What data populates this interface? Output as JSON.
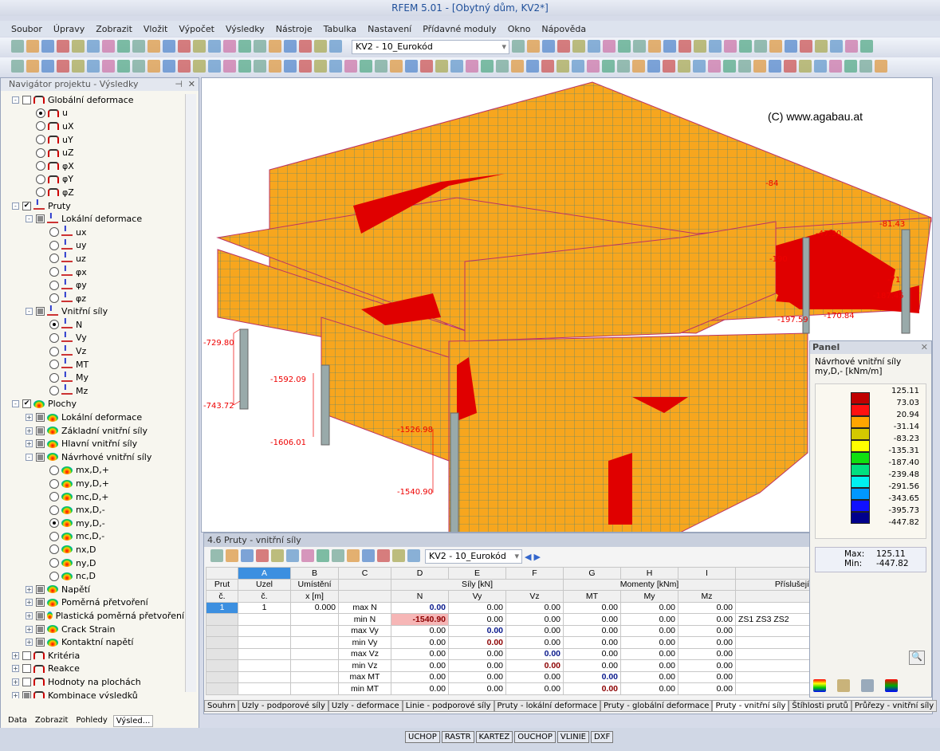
{
  "window": {
    "title": "RFEM 5.01 - [Obytný dům, KV2*]"
  },
  "menu": [
    "Soubor",
    "Úpravy",
    "Zobrazit",
    "Vložit",
    "Výpočet",
    "Výsledky",
    "Nástroje",
    "Tabulka",
    "Nastavení",
    "Přídavné moduly",
    "Okno",
    "Nápověda"
  ],
  "toolbar": {
    "load_case": "KV2 - 10_Eurokód"
  },
  "navigator": {
    "title": "Navigátor projektu - Výsledky",
    "items": [
      {
        "t": "Globální deformace",
        "lvl": 0,
        "k": "box",
        "exp": "-",
        "ic": "def"
      },
      {
        "t": "u",
        "lvl": 1,
        "k": "rad",
        "on": true,
        "ic": "def"
      },
      {
        "t": "uX",
        "lvl": 1,
        "k": "rad",
        "ic": "def"
      },
      {
        "t": "uY",
        "lvl": 1,
        "k": "rad",
        "ic": "def"
      },
      {
        "t": "uZ",
        "lvl": 1,
        "k": "rad",
        "ic": "def"
      },
      {
        "t": "φX",
        "lvl": 1,
        "k": "rad",
        "ic": "def"
      },
      {
        "t": "φY",
        "lvl": 1,
        "k": "rad",
        "ic": "def"
      },
      {
        "t": "φZ",
        "lvl": 1,
        "k": "rad",
        "ic": "def"
      },
      {
        "t": "Pruty",
        "lvl": 0,
        "k": "chk",
        "exp": "-",
        "ic": "bar"
      },
      {
        "t": "Lokální deformace",
        "lvl": 1,
        "k": "part",
        "exp": "-",
        "ic": "bar"
      },
      {
        "t": "ux",
        "lvl": 2,
        "k": "rad",
        "ic": "bar"
      },
      {
        "t": "uy",
        "lvl": 2,
        "k": "rad",
        "ic": "bar"
      },
      {
        "t": "uz",
        "lvl": 2,
        "k": "rad",
        "ic": "bar"
      },
      {
        "t": "φx",
        "lvl": 2,
        "k": "rad",
        "ic": "bar"
      },
      {
        "t": "φy",
        "lvl": 2,
        "k": "rad",
        "ic": "bar"
      },
      {
        "t": "φz",
        "lvl": 2,
        "k": "rad",
        "ic": "bar"
      },
      {
        "t": "Vnitřní síly",
        "lvl": 1,
        "k": "part",
        "exp": "-",
        "ic": "bar"
      },
      {
        "t": "N",
        "lvl": 2,
        "k": "rad",
        "on": true,
        "ic": "bar"
      },
      {
        "t": "Vy",
        "lvl": 2,
        "k": "rad",
        "ic": "bar"
      },
      {
        "t": "Vz",
        "lvl": 2,
        "k": "rad",
        "ic": "bar"
      },
      {
        "t": "MT",
        "lvl": 2,
        "k": "rad",
        "ic": "bar"
      },
      {
        "t": "My",
        "lvl": 2,
        "k": "rad",
        "ic": "bar"
      },
      {
        "t": "Mz",
        "lvl": 2,
        "k": "rad",
        "ic": "bar"
      },
      {
        "t": "Plochy",
        "lvl": 0,
        "k": "chk",
        "exp": "-",
        "ic": "surf"
      },
      {
        "t": "Lokální deformace",
        "lvl": 1,
        "k": "part",
        "exp": "+",
        "ic": "surf"
      },
      {
        "t": "Základní vnitřní síly",
        "lvl": 1,
        "k": "part",
        "exp": "+",
        "ic": "surf"
      },
      {
        "t": "Hlavní vnitřní síly",
        "lvl": 1,
        "k": "part",
        "exp": "+",
        "ic": "surf"
      },
      {
        "t": "Návrhové vnitřní síly",
        "lvl": 1,
        "k": "part",
        "exp": "-",
        "ic": "surf"
      },
      {
        "t": "mx,D,+",
        "lvl": 2,
        "k": "rad",
        "ic": "surf"
      },
      {
        "t": "my,D,+",
        "lvl": 2,
        "k": "rad",
        "ic": "surf"
      },
      {
        "t": "mc,D,+",
        "lvl": 2,
        "k": "rad",
        "ic": "surf"
      },
      {
        "t": "mx,D,-",
        "lvl": 2,
        "k": "rad",
        "ic": "surf"
      },
      {
        "t": "my,D,-",
        "lvl": 2,
        "k": "rad",
        "on": true,
        "ic": "surf"
      },
      {
        "t": "mc,D,-",
        "lvl": 2,
        "k": "rad",
        "ic": "surf"
      },
      {
        "t": "nx,D",
        "lvl": 2,
        "k": "rad",
        "ic": "surf"
      },
      {
        "t": "ny,D",
        "lvl": 2,
        "k": "rad",
        "ic": "surf"
      },
      {
        "t": "nc,D",
        "lvl": 2,
        "k": "rad",
        "ic": "surf"
      },
      {
        "t": "Napětí",
        "lvl": 1,
        "k": "part",
        "exp": "+",
        "ic": "surf"
      },
      {
        "t": "Poměrná přetvoření",
        "lvl": 1,
        "k": "part",
        "exp": "+",
        "ic": "surf"
      },
      {
        "t": "Plastická poměrná přetvoření",
        "lvl": 1,
        "k": "part",
        "exp": "+",
        "ic": "surf"
      },
      {
        "t": "Crack Strain",
        "lvl": 1,
        "k": "part",
        "exp": "+",
        "ic": "surf"
      },
      {
        "t": "Kontaktní napětí",
        "lvl": 1,
        "k": "part",
        "exp": "+",
        "ic": "surf"
      },
      {
        "t": "Kritéria",
        "lvl": 0,
        "k": "box",
        "exp": "+",
        "ic": "def"
      },
      {
        "t": "Reakce",
        "lvl": 0,
        "k": "box",
        "exp": "+",
        "ic": "def"
      },
      {
        "t": "Hodnoty na plochách",
        "lvl": 0,
        "k": "box",
        "exp": "+",
        "ic": "def"
      },
      {
        "t": "Kombinace výsledků",
        "lvl": 0,
        "k": "part",
        "exp": "+",
        "ic": "def"
      }
    ],
    "tabs": [
      "Data",
      "Zobrazit",
      "Pohledy",
      "Výsled..."
    ]
  },
  "view": {
    "copyright": "(C) www.agabau.at",
    "labels": [
      {
        "t": "-729.80"
      },
      {
        "t": "-743.72"
      },
      {
        "t": "-1592.09"
      },
      {
        "t": "-1606.01"
      },
      {
        "t": "-1526.98"
      },
      {
        "t": "-1540.90"
      },
      {
        "t": "-81.43"
      },
      {
        "t": "-47.30"
      },
      {
        "t": "-190"
      },
      {
        "t": "-71"
      },
      {
        "t": "-187.45"
      },
      {
        "t": "-197.59"
      },
      {
        "t": "-170.84"
      },
      {
        "t": "-84"
      }
    ]
  },
  "table": {
    "title": "4.6 Pruty - vnitřní síly",
    "load_case": "KV2 - 10_Eurokód",
    "cols": [
      "A",
      "B",
      "C",
      "D",
      "E",
      "F",
      "G",
      "H",
      "I"
    ],
    "h1": {
      "prut": "Prut",
      "uzel": "Uzel",
      "umisteni": "Umístění",
      "sily": "Síly [kN]",
      "momenty": "Momenty [kNm]",
      "prislusejici": "Příslušejí"
    },
    "h2": {
      "prut": "č.",
      "uzel": "č.",
      "x": "x [m]",
      "N": "N",
      "Vy": "Vy",
      "Vz": "Vz",
      "MT": "MT",
      "My": "My",
      "Mz": "Mz"
    },
    "rows": [
      {
        "prut": "1",
        "uzel": "1",
        "x": "0.000",
        "type": "max N",
        "v": [
          "0.00",
          "0.00",
          "0.00",
          "0.00",
          "0.00",
          "0.00"
        ],
        "hl": 0,
        "c": "bl",
        "p": ""
      },
      {
        "prut": "",
        "uzel": "",
        "x": "",
        "type": "min N",
        "v": [
          "-1540.90",
          "0.00",
          "0.00",
          "0.00",
          "0.00",
          "0.00"
        ],
        "hl": 0,
        "c": "rd",
        "p": "ZS1 ZS3 ZS2"
      },
      {
        "prut": "",
        "uzel": "",
        "x": "",
        "type": "max Vy",
        "v": [
          "0.00",
          "0.00",
          "0.00",
          "0.00",
          "0.00",
          "0.00"
        ],
        "hl": 1,
        "c": "bl",
        "p": ""
      },
      {
        "prut": "",
        "uzel": "",
        "x": "",
        "type": "min Vy",
        "v": [
          "0.00",
          "0.00",
          "0.00",
          "0.00",
          "0.00",
          "0.00"
        ],
        "hl": 1,
        "c": "rd",
        "p": ""
      },
      {
        "prut": "",
        "uzel": "",
        "x": "",
        "type": "max Vz",
        "v": [
          "0.00",
          "0.00",
          "0.00",
          "0.00",
          "0.00",
          "0.00"
        ],
        "hl": 2,
        "c": "bl",
        "p": ""
      },
      {
        "prut": "",
        "uzel": "",
        "x": "",
        "type": "min Vz",
        "v": [
          "0.00",
          "0.00",
          "0.00",
          "0.00",
          "0.00",
          "0.00"
        ],
        "hl": 2,
        "c": "rd",
        "p": ""
      },
      {
        "prut": "",
        "uzel": "",
        "x": "",
        "type": "max MT",
        "v": [
          "0.00",
          "0.00",
          "0.00",
          "0.00",
          "0.00",
          "0.00"
        ],
        "hl": 3,
        "c": "bl",
        "p": ""
      },
      {
        "prut": "",
        "uzel": "",
        "x": "",
        "type": "min MT",
        "v": [
          "0.00",
          "0.00",
          "0.00",
          "0.00",
          "0.00",
          "0.00"
        ],
        "hl": 3,
        "c": "rd",
        "p": ""
      }
    ],
    "tabs": [
      "Souhrn",
      "Uzly - podporové síly",
      "Uzly - deformace",
      "Linie - podporové síly",
      "Pruty - lokální deformace",
      "Pruty - globální deformace",
      "Pruty - vnitřní síly",
      "Štíhlosti prutů",
      "Průřezy - vnitřní síly"
    ],
    "active_tab": "Pruty - vnitřní síly"
  },
  "panel": {
    "title": "Panel",
    "line1": "Návrhové vnitřní síly",
    "line2": "my,D,- [kNm/m]",
    "values": [
      "125.11",
      "73.03",
      "20.94",
      "-31.14",
      "-83.23",
      "-135.31",
      "-187.40",
      "-239.48",
      "-291.56",
      "-343.65",
      "-395.73",
      "-447.82"
    ],
    "colors": [
      "#c00000",
      "#ff1010",
      "#ffa500",
      "#d4c800",
      "#ffff00",
      "#10e010",
      "#00e080",
      "#00f0f0",
      "#0098ff",
      "#1010ff",
      "#00008c"
    ],
    "max_label": "Max:",
    "max": "125.11",
    "min_label": "Min:",
    "min": "-447.82"
  },
  "status": [
    "UCHOP",
    "RASTR",
    "KARTEZ",
    "OUCHOP",
    "VLINIE",
    "DXF"
  ]
}
